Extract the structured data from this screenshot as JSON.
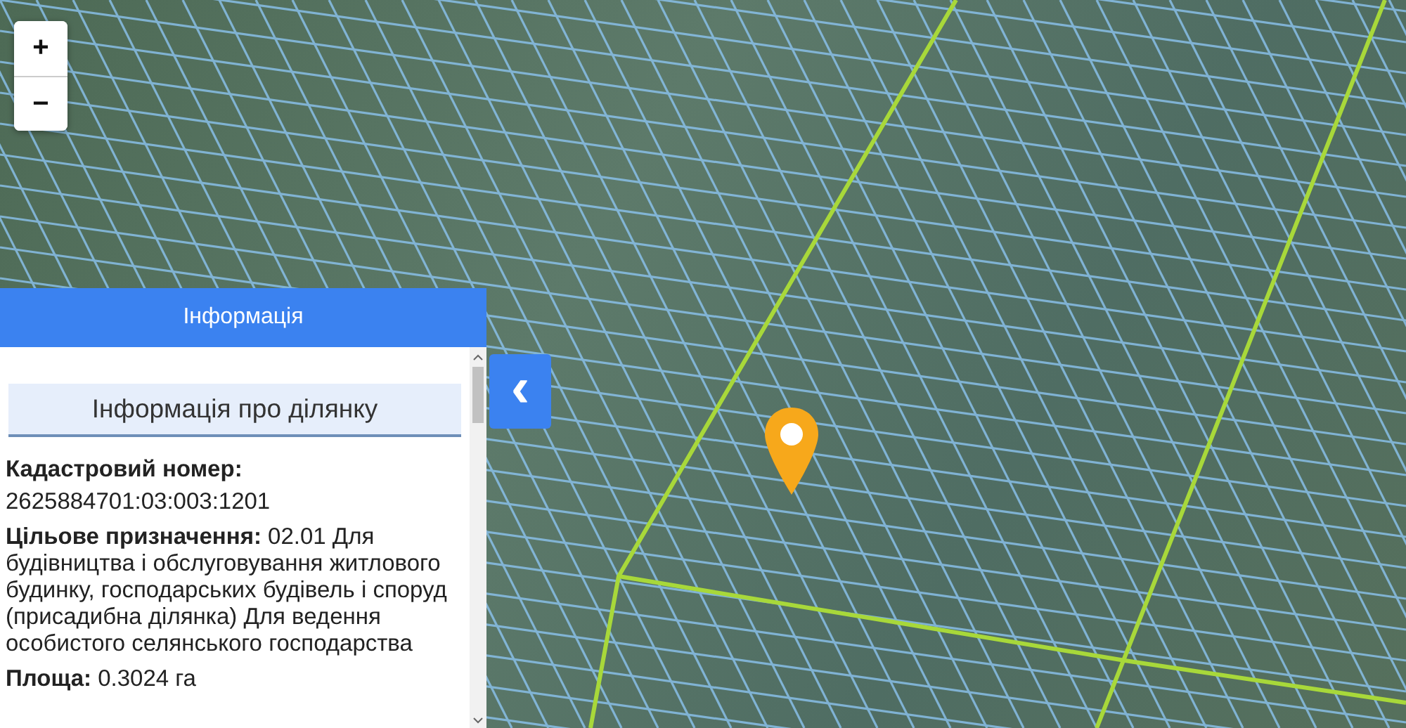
{
  "zoom_controls": [
    {
      "label": "+"
    },
    {
      "label": "−"
    }
  ],
  "panel": {
    "title": "Інформація",
    "section_title": "Інформація про ділянку",
    "cadastral_label": "Кадастровий номер:",
    "cadastral_value": "2625884701:03:003:1201",
    "details": [
      "**Цільове призначення:** 02.01 Для будівництва і обслуговування житлового будинку, господарських будівель і споруд (присадибна ділянка) Для ведення особистого селянського господарства",
      "**Площа:** 0.3024 га"
    ]
  },
  "collapse_button": {
    "label": "‹"
  }
}
